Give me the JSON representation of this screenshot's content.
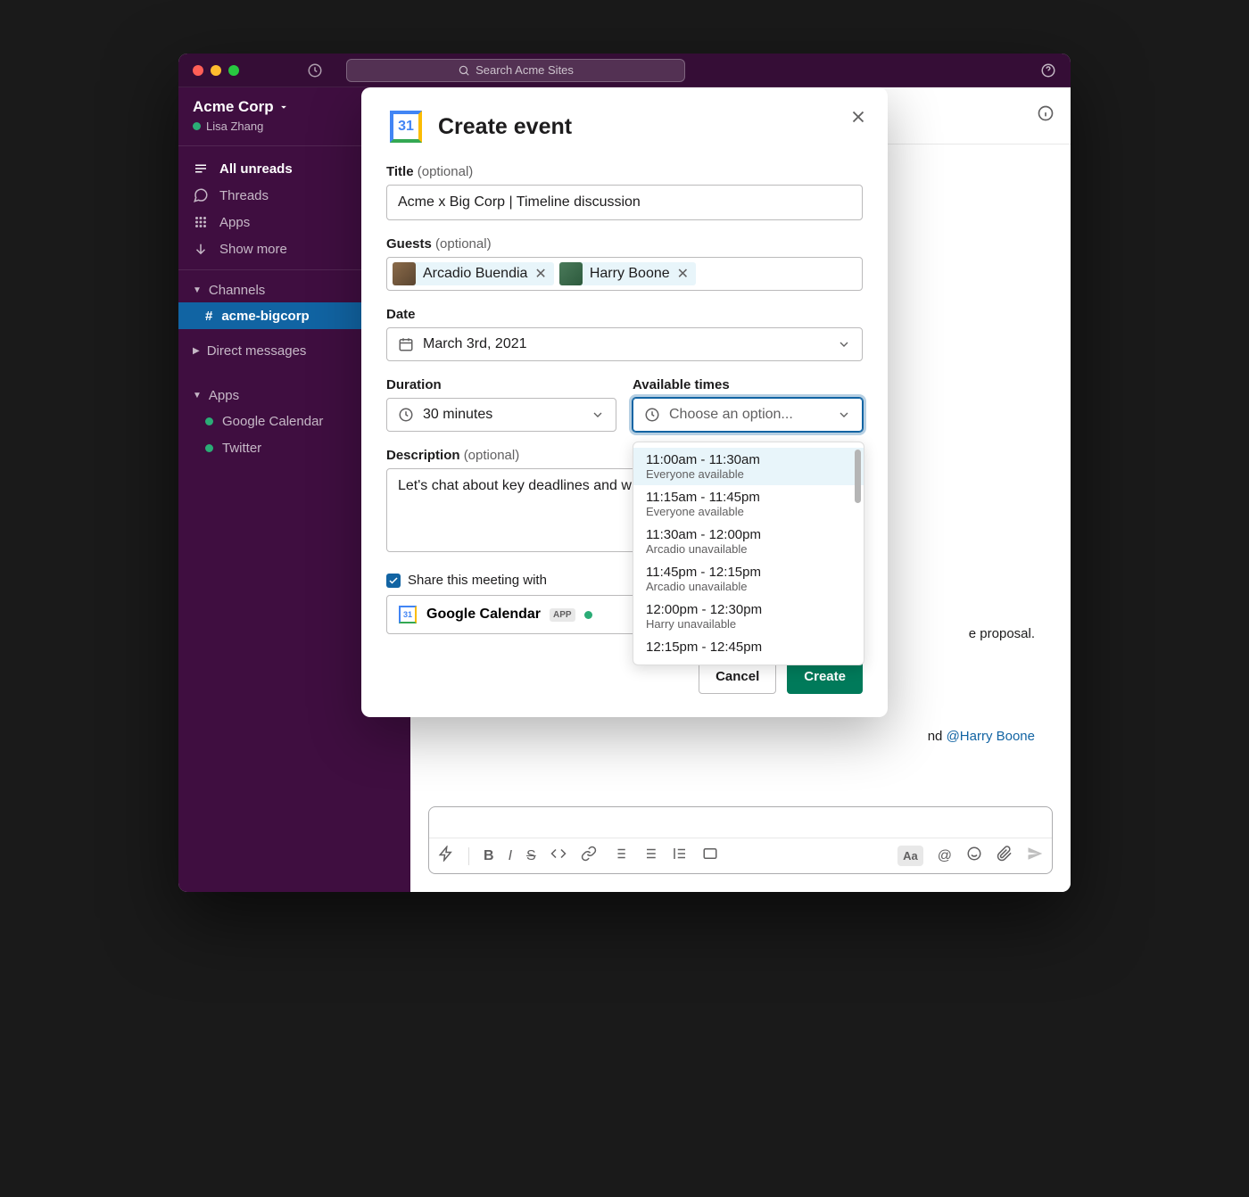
{
  "titlebar": {
    "search_text": "Search Acme Sites"
  },
  "sidebar": {
    "workspace": "Acme Corp",
    "user": "Lisa Zhang",
    "nav": {
      "all_unreads": "All unreads",
      "threads": "Threads",
      "apps": "Apps",
      "show_more": "Show more"
    },
    "sections": {
      "channels": "Channels",
      "direct_messages": "Direct messages",
      "apps": "Apps"
    },
    "channel_active": "acme-bigcorp",
    "app_items": {
      "gcal": "Google Calendar",
      "twitter": "Twitter"
    }
  },
  "content": {
    "proposal_fragment": "e proposal.",
    "mention1_prefix": "nd ",
    "mention1": "@Harry Boone"
  },
  "modal": {
    "icon_day": "31",
    "title": "Create event",
    "title_field": {
      "label": "Title",
      "opt": "(optional)",
      "value": "Acme x Big Corp | Timeline discussion"
    },
    "guests_field": {
      "label": "Guests",
      "opt": "(optional)",
      "chips": [
        {
          "name": "Arcadio Buendia"
        },
        {
          "name": "Harry Boone"
        }
      ]
    },
    "date_field": {
      "label": "Date",
      "value": "March 3rd, 2021"
    },
    "duration_field": {
      "label": "Duration",
      "value": "30 minutes"
    },
    "times_field": {
      "label": "Available times",
      "placeholder": "Choose an option..."
    },
    "desc_field": {
      "label": "Description",
      "opt": "(optional)",
      "value": "Let's chat about key deadlines and w"
    },
    "share_label": "Share this meeting with",
    "share_target": "Google Calendar",
    "share_badge": "APP",
    "footer": {
      "cancel": "Cancel",
      "create": "Create"
    },
    "dropdown": {
      "options": [
        {
          "time": "11:00am - 11:30am",
          "sub": "Everyone available"
        },
        {
          "time": "11:15am - 11:45pm",
          "sub": "Everyone available"
        },
        {
          "time": "11:30am - 12:00pm",
          "sub": "Arcadio unavailable"
        },
        {
          "time": "11:45pm - 12:15pm",
          "sub": "Arcadio unavailable"
        },
        {
          "time": "12:00pm - 12:30pm",
          "sub": "Harry unavailable"
        },
        {
          "time": "12:15pm - 12:45pm",
          "sub": ""
        }
      ]
    }
  }
}
